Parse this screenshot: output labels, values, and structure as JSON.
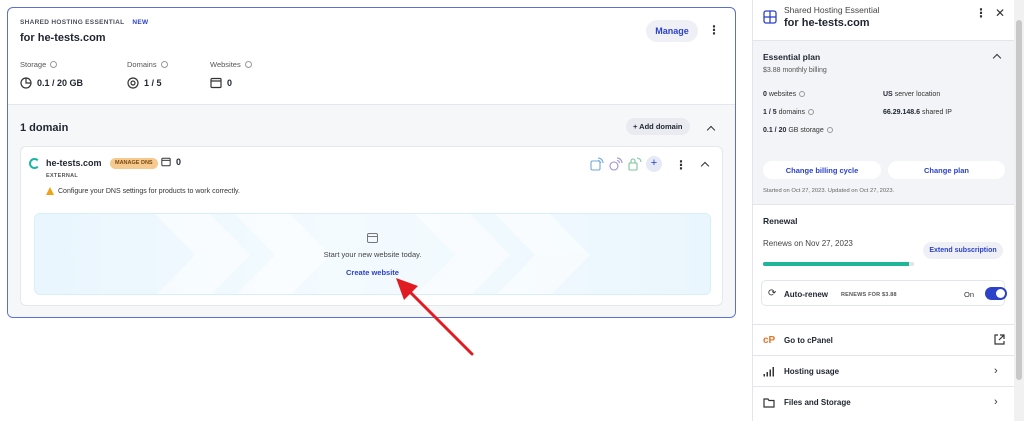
{
  "card": {
    "plan_type": "SHARED HOSTING ESSENTIAL",
    "new_badge": "NEW",
    "title": "for he-tests.com",
    "manage_label": "Manage",
    "stats": {
      "storage_label": "Storage",
      "storage_value": "0.1 / 20 GB",
      "domains_label": "Domains",
      "domains_value": "1 / 5",
      "websites_label": "Websites",
      "websites_value": "0"
    }
  },
  "domains": {
    "count_label": "1 domain",
    "add_label": "+ Add domain",
    "domain": {
      "name": "he-tests.com",
      "dns_badge": "MANAGE DNS",
      "site_count": "0",
      "type": "EXTERNAL",
      "warning": "Configure your DNS settings for products to work correctly."
    },
    "hero": {
      "text": "Start your new website today.",
      "link": "Create website"
    }
  },
  "panel": {
    "subtitle": "Shared Hosting Essential",
    "title": "for he-tests.com",
    "plan": {
      "title": "Essential plan",
      "billing": "$3.88 monthly billing",
      "websites_value": "0",
      "websites_label": "websites",
      "domains_value": "1 / 5",
      "domains_label": "domains",
      "storage_value": "0.1 / 20",
      "storage_label": "GB storage",
      "location_value": "US",
      "location_label": "server location",
      "ip_value": "66.29.148.6",
      "ip_label": "shared IP",
      "change_billing": "Change billing cycle",
      "change_plan": "Change plan",
      "started": "Started on Oct 27, 2023. Updated on Oct 27, 2023."
    },
    "renewal": {
      "title": "Renewal",
      "renews_on": "Renews on Nov 27, 2023",
      "extend": "Extend subscription",
      "progress_fraction": 0.97,
      "autorenew_label": "Auto-renew",
      "autorenew_sub": "RENEWS FOR $3.88",
      "autorenew_state": "On"
    },
    "menu": {
      "cpanel": "Go to cPanel",
      "usage": "Hosting usage",
      "files": "Files and Storage"
    }
  },
  "colors": {
    "accent": "#2c42c8",
    "progress": "#1fb598",
    "arrow": "#e11b22",
    "warning": "#f0a21a"
  }
}
